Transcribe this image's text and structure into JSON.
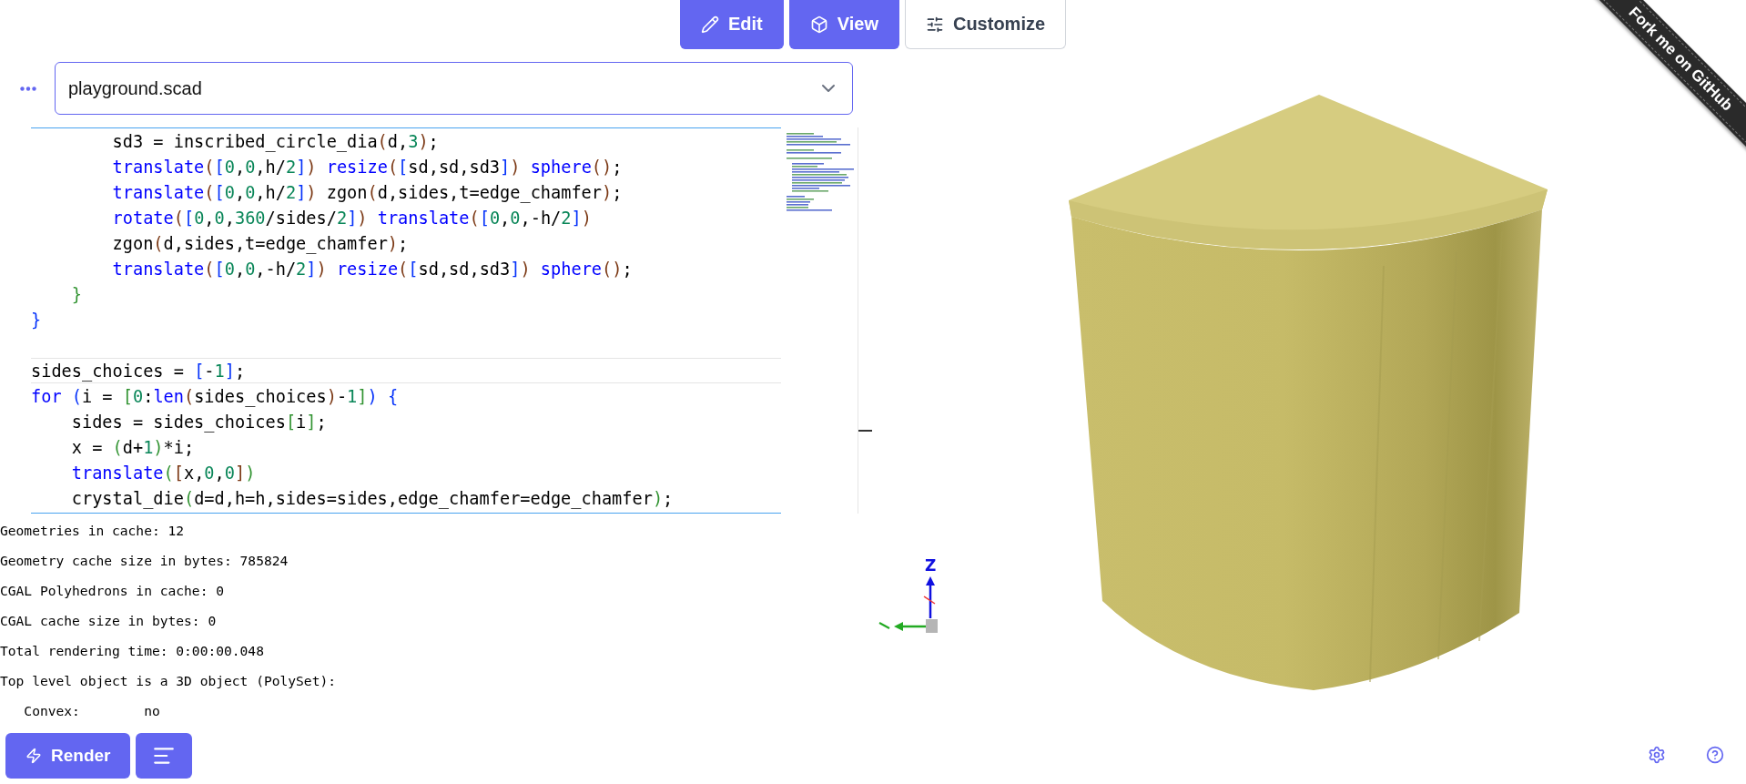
{
  "mode_tabs": [
    {
      "label": "Edit",
      "selected": true
    },
    {
      "label": "View",
      "selected": true
    },
    {
      "label": "Customize",
      "selected": false
    }
  ],
  "file_select": {
    "value": "playground.scad"
  },
  "editor": {
    "lines": [
      {
        "current": false,
        "tokens": [
          {
            "kind": "plain",
            "text": "        sd3 = inscribed_circle_dia"
          },
          {
            "kind": "bracket2",
            "text": "("
          },
          {
            "kind": "plain",
            "text": "d,"
          },
          {
            "kind": "number",
            "text": "3"
          },
          {
            "kind": "bracket2",
            "text": ")"
          },
          {
            "kind": "plain",
            "text": ";"
          }
        ]
      },
      {
        "current": false,
        "tokens": [
          {
            "kind": "function",
            "text": "        translate"
          },
          {
            "kind": "bracket2",
            "text": "("
          },
          {
            "kind": "bracket0",
            "text": "["
          },
          {
            "kind": "number",
            "text": "0"
          },
          {
            "kind": "plain",
            "text": ","
          },
          {
            "kind": "number",
            "text": "0"
          },
          {
            "kind": "plain",
            "text": ",h/"
          },
          {
            "kind": "number",
            "text": "2"
          },
          {
            "kind": "bracket0",
            "text": "]"
          },
          {
            "kind": "bracket2",
            "text": ")"
          },
          {
            "kind": "function",
            "text": " resize"
          },
          {
            "kind": "bracket2",
            "text": "("
          },
          {
            "kind": "bracket0",
            "text": "["
          },
          {
            "kind": "plain",
            "text": "sd,sd,sd3"
          },
          {
            "kind": "bracket0",
            "text": "]"
          },
          {
            "kind": "bracket2",
            "text": ")"
          },
          {
            "kind": "function",
            "text": " sphere"
          },
          {
            "kind": "bracket2",
            "text": "()"
          },
          {
            "kind": "plain",
            "text": ";"
          }
        ]
      },
      {
        "current": false,
        "tokens": [
          {
            "kind": "function",
            "text": "        translate"
          },
          {
            "kind": "bracket2",
            "text": "("
          },
          {
            "kind": "bracket0",
            "text": "["
          },
          {
            "kind": "number",
            "text": "0"
          },
          {
            "kind": "plain",
            "text": ","
          },
          {
            "kind": "number",
            "text": "0"
          },
          {
            "kind": "plain",
            "text": ",h/"
          },
          {
            "kind": "number",
            "text": "2"
          },
          {
            "kind": "bracket0",
            "text": "]"
          },
          {
            "kind": "bracket2",
            "text": ")"
          },
          {
            "kind": "plain",
            "text": " zgon"
          },
          {
            "kind": "bracket2",
            "text": "("
          },
          {
            "kind": "plain",
            "text": "d,sides,t=edge_chamfer"
          },
          {
            "kind": "bracket2",
            "text": ")"
          },
          {
            "kind": "plain",
            "text": ";"
          }
        ]
      },
      {
        "current": false,
        "tokens": [
          {
            "kind": "function",
            "text": "        rotate"
          },
          {
            "kind": "bracket2",
            "text": "("
          },
          {
            "kind": "bracket0",
            "text": "["
          },
          {
            "kind": "number",
            "text": "0"
          },
          {
            "kind": "plain",
            "text": ","
          },
          {
            "kind": "number",
            "text": "0"
          },
          {
            "kind": "plain",
            "text": ","
          },
          {
            "kind": "number",
            "text": "360"
          },
          {
            "kind": "plain",
            "text": "/sides/"
          },
          {
            "kind": "number",
            "text": "2"
          },
          {
            "kind": "bracket0",
            "text": "]"
          },
          {
            "kind": "bracket2",
            "text": ")"
          },
          {
            "kind": "function",
            "text": " translate"
          },
          {
            "kind": "bracket2",
            "text": "("
          },
          {
            "kind": "bracket0",
            "text": "["
          },
          {
            "kind": "number",
            "text": "0"
          },
          {
            "kind": "plain",
            "text": ","
          },
          {
            "kind": "number",
            "text": "0"
          },
          {
            "kind": "plain",
            "text": ",-h/"
          },
          {
            "kind": "number",
            "text": "2"
          },
          {
            "kind": "bracket0",
            "text": "]"
          },
          {
            "kind": "bracket2",
            "text": ")"
          }
        ]
      },
      {
        "current": false,
        "tokens": [
          {
            "kind": "plain",
            "text": "        zgon"
          },
          {
            "kind": "bracket2",
            "text": "("
          },
          {
            "kind": "plain",
            "text": "d,sides,t=edge_chamfer"
          },
          {
            "kind": "bracket2",
            "text": ")"
          },
          {
            "kind": "plain",
            "text": ";"
          }
        ]
      },
      {
        "current": false,
        "tokens": [
          {
            "kind": "function",
            "text": "        translate"
          },
          {
            "kind": "bracket2",
            "text": "("
          },
          {
            "kind": "bracket0",
            "text": "["
          },
          {
            "kind": "number",
            "text": "0"
          },
          {
            "kind": "plain",
            "text": ","
          },
          {
            "kind": "number",
            "text": "0"
          },
          {
            "kind": "plain",
            "text": ",-h/"
          },
          {
            "kind": "number",
            "text": "2"
          },
          {
            "kind": "bracket0",
            "text": "]"
          },
          {
            "kind": "bracket2",
            "text": ")"
          },
          {
            "kind": "function",
            "text": " resize"
          },
          {
            "kind": "bracket2",
            "text": "("
          },
          {
            "kind": "bracket0",
            "text": "["
          },
          {
            "kind": "plain",
            "text": "sd,sd,sd3"
          },
          {
            "kind": "bracket0",
            "text": "]"
          },
          {
            "kind": "bracket2",
            "text": ")"
          },
          {
            "kind": "function",
            "text": " sphere"
          },
          {
            "kind": "bracket2",
            "text": "()"
          },
          {
            "kind": "plain",
            "text": ";"
          }
        ]
      },
      {
        "current": false,
        "tokens": [
          {
            "kind": "bracket1",
            "text": "    }"
          }
        ]
      },
      {
        "current": false,
        "tokens": [
          {
            "kind": "bracket0",
            "text": "}"
          }
        ]
      },
      {
        "current": false
      },
      {
        "current": true,
        "tokens": [
          {
            "kind": "plain",
            "text": "sides_choices = "
          },
          {
            "kind": "bracket0",
            "text": "["
          },
          {
            "kind": "plain",
            "text": "-"
          },
          {
            "kind": "number",
            "text": "1"
          },
          {
            "kind": "bracket0",
            "text": "]"
          },
          {
            "kind": "plain",
            "text": ";"
          }
        ]
      },
      {
        "current": false,
        "tokens": [
          {
            "kind": "function",
            "text": "for"
          },
          {
            "kind": "bracket0",
            "text": " ("
          },
          {
            "kind": "plain",
            "text": "i = "
          },
          {
            "kind": "bracket1",
            "text": "["
          },
          {
            "kind": "number",
            "text": "0"
          },
          {
            "kind": "plain",
            "text": ":"
          },
          {
            "kind": "function",
            "text": "len"
          },
          {
            "kind": "bracket2",
            "text": "("
          },
          {
            "kind": "plain",
            "text": "sides_choices"
          },
          {
            "kind": "bracket2",
            "text": ")"
          },
          {
            "kind": "plain",
            "text": "-"
          },
          {
            "kind": "number",
            "text": "1"
          },
          {
            "kind": "bracket1",
            "text": "]"
          },
          {
            "kind": "bracket0",
            "text": ")"
          },
          {
            "kind": "bracket0",
            "text": " {"
          }
        ]
      },
      {
        "current": false,
        "tokens": [
          {
            "kind": "plain",
            "text": "    sides = sides_choices"
          },
          {
            "kind": "bracket1",
            "text": "["
          },
          {
            "kind": "plain",
            "text": "i"
          },
          {
            "kind": "bracket1",
            "text": "]"
          },
          {
            "kind": "plain",
            "text": ";"
          }
        ]
      },
      {
        "current": false,
        "tokens": [
          {
            "kind": "plain",
            "text": "    x = "
          },
          {
            "kind": "bracket1",
            "text": "("
          },
          {
            "kind": "plain",
            "text": "d+"
          },
          {
            "kind": "number",
            "text": "1"
          },
          {
            "kind": "bracket1",
            "text": ")"
          },
          {
            "kind": "plain",
            "text": "*i;"
          }
        ]
      },
      {
        "current": false,
        "tokens": [
          {
            "kind": "function",
            "text": "    translate"
          },
          {
            "kind": "bracket1",
            "text": "("
          },
          {
            "kind": "bracket2",
            "text": "["
          },
          {
            "kind": "plain",
            "text": "x,"
          },
          {
            "kind": "number",
            "text": "0"
          },
          {
            "kind": "plain",
            "text": ","
          },
          {
            "kind": "number",
            "text": "0"
          },
          {
            "kind": "bracket2",
            "text": "]"
          },
          {
            "kind": "bracket1",
            "text": ")"
          }
        ]
      },
      {
        "current": false,
        "tokens": [
          {
            "kind": "plain",
            "text": "    crystal_die"
          },
          {
            "kind": "bracket1",
            "text": "("
          },
          {
            "kind": "plain",
            "text": "d=d,h=h,sides=sides,edge_chamfer=edge_chamfer"
          },
          {
            "kind": "bracket1",
            "text": ")"
          },
          {
            "kind": "plain",
            "text": ";"
          }
        ]
      }
    ]
  },
  "log": [
    "Geometries in cache: 12",
    "Geometry cache size in bytes: 785824",
    "CGAL Polyhedrons in cache: 0",
    "CGAL cache size in bytes: 0",
    "Total rendering time: 0:00:00.048",
    "Top level object is a 3D object (PolySet):",
    "   Convex:        no"
  ],
  "render_button": {
    "label": "Render"
  },
  "viewer": {
    "axis_label": "Z"
  },
  "ribbon": {
    "label": "Fork me on GitHub"
  }
}
